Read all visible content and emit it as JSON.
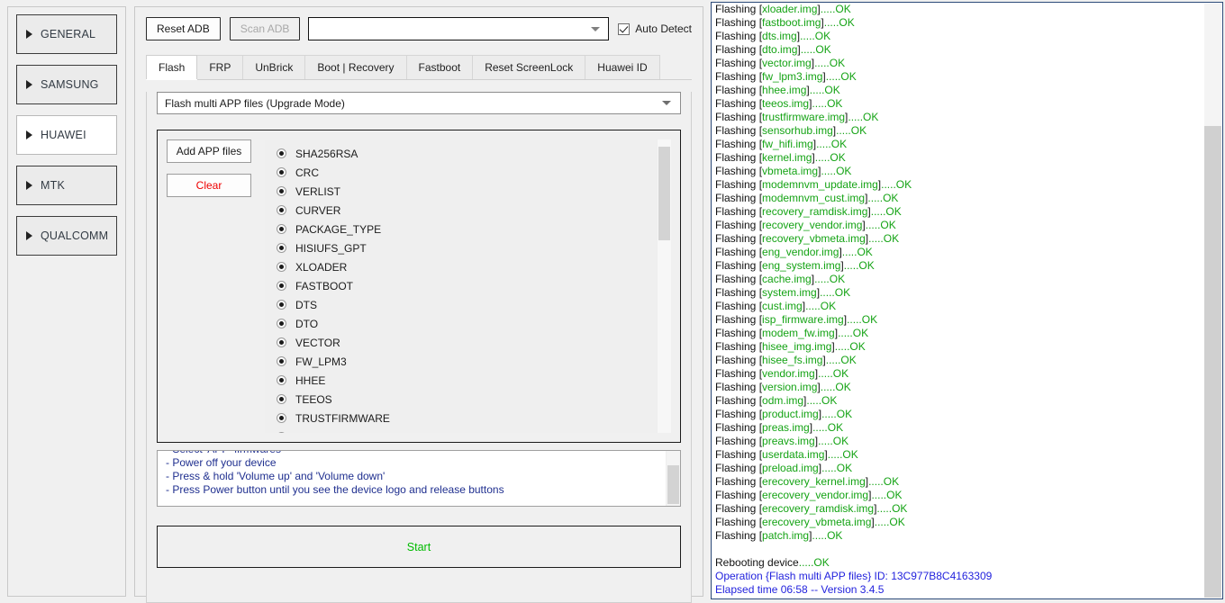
{
  "sidebar": {
    "items": [
      {
        "label": "GENERAL",
        "active": false
      },
      {
        "label": "SAMSUNG",
        "active": false
      },
      {
        "label": "HUAWEI",
        "active": true
      },
      {
        "label": "MTK",
        "active": false
      },
      {
        "label": "QUALCOMM",
        "active": false
      }
    ]
  },
  "toolbar": {
    "reset_adb_label": "Reset ADB",
    "scan_adb_label": "Scan ADB",
    "device_combo_value": "",
    "auto_detect_label": "Auto Detect",
    "auto_detect_checked": true
  },
  "tabs": [
    {
      "label": "Flash",
      "active": true
    },
    {
      "label": "FRP",
      "active": false
    },
    {
      "label": "UnBrick",
      "active": false
    },
    {
      "label": "Boot | Recovery",
      "active": false
    },
    {
      "label": "Fastboot",
      "active": false
    },
    {
      "label": "Reset ScreenLock",
      "active": false
    },
    {
      "label": "Huawei ID",
      "active": false
    }
  ],
  "flash": {
    "mode_value": "Flash multi APP files (Upgrade Mode)",
    "add_files_label": "Add APP files",
    "clear_label": "Clear",
    "partitions": [
      "SHA256RSA",
      "CRC",
      "VERLIST",
      "CURVER",
      "PACKAGE_TYPE",
      "HISIUFS_GPT",
      "XLOADER",
      "FASTBOOT",
      "DTS",
      "DTO",
      "VECTOR",
      "FW_LPM3",
      "HHEE",
      "TEEOS",
      "TRUSTFIRMWARE",
      "SENSORHUB"
    ],
    "instructions": [
      "- Select 'APP' firmwares",
      "- Power off your device",
      "- Press & hold 'Volume up' and 'Volume down'",
      "- Press Power button until you see the device logo and release buttons"
    ],
    "start_label": "Start"
  },
  "log": {
    "flash_prefix": "Flashing [",
    "flash_suffix": "]",
    "ok_suffix": ".....OK",
    "flashed": [
      "xloader.img",
      "fastboot.img",
      "dts.img",
      "dto.img",
      "vector.img",
      "fw_lpm3.img",
      "hhee.img",
      "teeos.img",
      "trustfirmware.img",
      "sensorhub.img",
      "fw_hifi.img",
      "kernel.img",
      "vbmeta.img",
      "modemnvm_update.img",
      "modemnvm_cust.img",
      "recovery_ramdisk.img",
      "recovery_vendor.img",
      "recovery_vbmeta.img",
      "eng_vendor.img",
      "eng_system.img",
      "cache.img",
      "system.img",
      "cust.img",
      "isp_firmware.img",
      "modem_fw.img",
      "hisee_img.img",
      "hisee_fs.img",
      "vendor.img",
      "version.img",
      "odm.img",
      "product.img",
      "preas.img",
      "preavs.img",
      "userdata.img",
      "preload.img",
      "erecovery_kernel.img",
      "erecovery_vendor.img",
      "erecovery_ramdisk.img",
      "erecovery_vbmeta.img",
      "patch.img"
    ],
    "reboot_text": "Rebooting device",
    "reboot_ok": ".....OK",
    "operation_line": "Operation {Flash multi APP files} ID: 13C977B8C4163309",
    "elapsed_line": "Elapsed time 06:58 -- Version 3.4.5"
  },
  "colors": {
    "ok_green": "#14a314",
    "link_blue": "#2222dd",
    "clear_red": "#ee0000",
    "start_green": "#00bb00",
    "instruction_blue": "#1f2f8f"
  }
}
